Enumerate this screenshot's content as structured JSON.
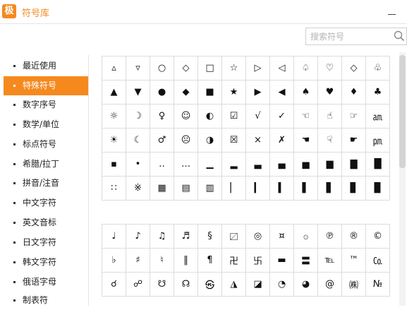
{
  "app": {
    "logo_text": "极",
    "title": "符号库"
  },
  "search": {
    "placeholder": "搜索符号",
    "value": ""
  },
  "sidebar": {
    "items": [
      {
        "label": "最近使用",
        "active": false
      },
      {
        "label": "特殊符号",
        "active": true
      },
      {
        "label": "数字序号",
        "active": false
      },
      {
        "label": "数学/单位",
        "active": false
      },
      {
        "label": "标点符号",
        "active": false
      },
      {
        "label": "希腊/拉丁",
        "active": false
      },
      {
        "label": "拼音/注音",
        "active": false
      },
      {
        "label": "中文字符",
        "active": false
      },
      {
        "label": "英文音标",
        "active": false
      },
      {
        "label": "日文字符",
        "active": false
      },
      {
        "label": "韩文字符",
        "active": false
      },
      {
        "label": "俄语字母",
        "active": false
      },
      {
        "label": "制表符",
        "active": false
      }
    ]
  },
  "grids": [
    {
      "symbols": [
        "▵",
        "▿",
        "○",
        "◇",
        "□",
        "☆",
        "▷",
        "◁",
        "♤",
        "♡",
        "◇",
        "♧",
        "▲",
        "▼",
        "●",
        "◆",
        "■",
        "★",
        "▶",
        "◀",
        "♠",
        "♥",
        "♦",
        "♣",
        "☼",
        "☽",
        "♀",
        "☺",
        "◐",
        "☑",
        "√",
        "✓",
        "☜",
        "☝",
        "☞",
        "㏂",
        "☀",
        "☾",
        "♂",
        "☹",
        "◑",
        "☒",
        "×",
        "✗",
        "☚",
        "☟",
        "☛",
        "㏘",
        "▪",
        "•",
        "‥",
        "…",
        "▁",
        "▂",
        "▃",
        "▄",
        "▅",
        "▆",
        "▇",
        "█",
        "∷",
        "※",
        "▦",
        "▤",
        "▥",
        "▏",
        "▎",
        "▍",
        "▌",
        "▋",
        "▊",
        "▉"
      ]
    },
    {
      "symbols": [
        "♩",
        "♪",
        "♫",
        "♬",
        "§",
        "〼",
        "◎",
        "¤",
        "۞",
        "℗",
        "®",
        "©",
        "♭",
        "♯",
        "♮",
        "‖",
        "¶",
        "卍",
        "卐",
        "▬",
        "〓",
        "℡",
        "™",
        "㏇",
        "☌",
        "☍",
        "☋",
        "☊",
        "㉿",
        "◮",
        "◪",
        "◔",
        "◕",
        "@",
        "㈱",
        "№"
      ]
    }
  ]
}
